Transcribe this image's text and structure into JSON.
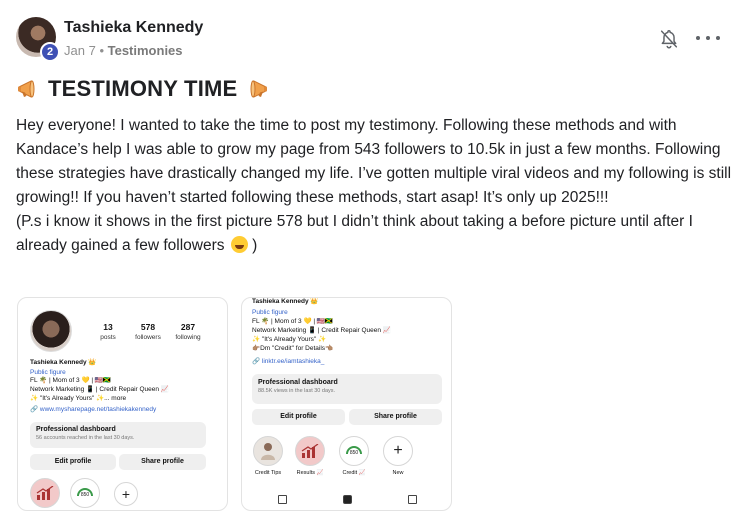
{
  "post": {
    "author": "Tashieka Kennedy",
    "level": "2",
    "date": "Jan 7",
    "separator": "•",
    "category": "Testimonies",
    "title": "TESTIMONY TIME",
    "paragraph1": "Hey everyone! I wanted to take the time to post my testimony. Following these methods and with Kandace’s help I was able to grow my page from 543 followers to 10.5k in just a few months. Following these strategies have drastically changed my life. I’ve gotten multiple viral videos and my following is still growing!! If you haven’t started following these methods, start asap! It’s only up 2025!!!",
    "paragraph2": "(P.s i know it shows in the first picture 578 but I didn’t think about taking a before picture until after I already gained a few followers",
    "paragraph2_end": ")"
  },
  "icons": {
    "notification": "bell-off-icon",
    "more": "more-options-icon",
    "title_emoji": "megaphone-icon",
    "end_emoji": "grinning-sweat-emoji"
  },
  "colors": {
    "level_badge": "#3f51b5",
    "link": "#3563c9",
    "megaphone": "#f0a04b"
  },
  "screenshot1": {
    "posts_n": "13",
    "posts_l": "posts",
    "followers_n": "578",
    "followers_l": "followers",
    "following_n": "287",
    "following_l": "following",
    "name": "Tashieka Kennedy 👑",
    "category": "Public figure",
    "bio1": "FL 🌴 | Mom of 3 💛 | 🇺🇸🇯🇲",
    "bio2": "Network Marketing 📱 | Credit Repair Queen 📈",
    "bio3": "✨ \"It's Already Yours\" ✨... more",
    "link": "🔗 www.mysharepage.net/tashiekakennedy",
    "dash_title": "Professional dashboard",
    "dash_sub": "56 accounts reached in the last 30 days.",
    "edit": "Edit profile",
    "share": "Share profile",
    "new": "+"
  },
  "screenshot2": {
    "name": "Tashieka Kennedy 👑",
    "category": "Public figure",
    "bio1": "FL 🌴 | Mom of 3 💛 | 🇺🇸🇯🇲",
    "bio2": "Network Marketing 📱 | Credit Repair Queen 📈",
    "bio3": "✨ \"It's Already Yours\" ✨",
    "bio4": "👉🏽Dm \"Credit\" for Details👈🏽",
    "link": "🔗 linktr.ee/iamtashieka_",
    "dash_title": "Professional dashboard",
    "dash_sub": "88.5K views in the last 30 days.",
    "edit": "Edit profile",
    "share": "Share profile",
    "highlights": [
      "Credit Tips",
      "Results 📈",
      "Credit 📈",
      "New"
    ],
    "new": "+"
  }
}
